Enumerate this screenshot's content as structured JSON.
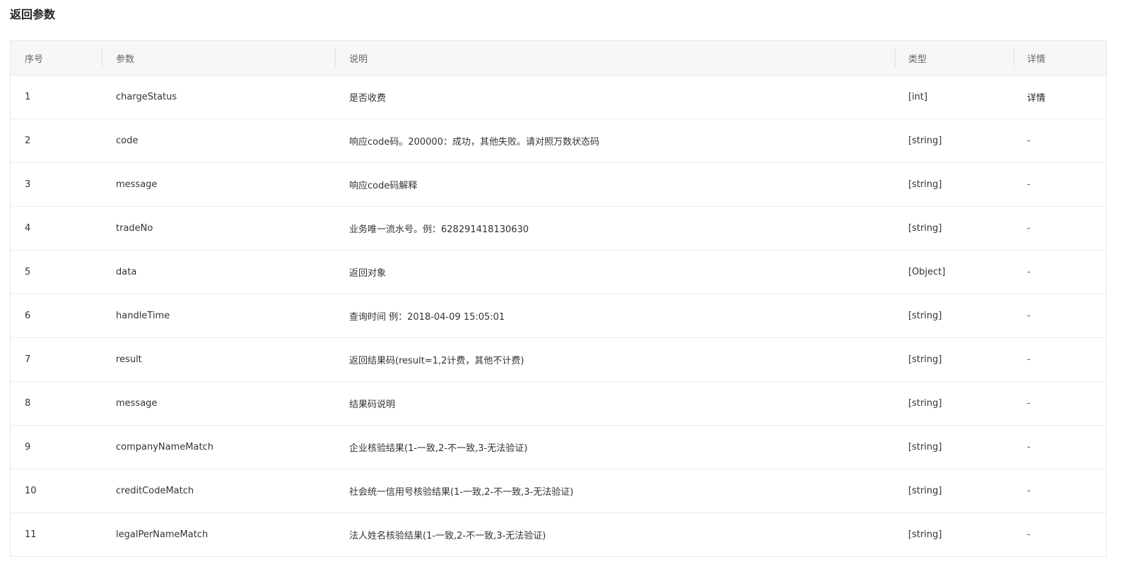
{
  "section": {
    "title": "返回参数"
  },
  "table": {
    "headers": {
      "no": "序号",
      "param": "参数",
      "desc": "说明",
      "type": "类型",
      "detail": "详情"
    },
    "rows": [
      {
        "no": "1",
        "param": "chargeStatus",
        "desc": "是否收费",
        "type": "[int]",
        "detail": "详情"
      },
      {
        "no": "2",
        "param": "code",
        "desc": "响应code码。200000：成功，其他失败。请对照万数状态码",
        "type": "[string]",
        "detail": "-"
      },
      {
        "no": "3",
        "param": "message",
        "desc": "响应code码解释",
        "type": "[string]",
        "detail": "-"
      },
      {
        "no": "4",
        "param": "tradeNo",
        "desc": "业务唯一流水号。例：628291418130630",
        "type": "[string]",
        "detail": "-"
      },
      {
        "no": "5",
        "param": "data",
        "desc": "返回对象",
        "type": "[Object]",
        "detail": "-"
      },
      {
        "no": "6",
        "param": "handleTime",
        "desc": "查询时间 例：2018-04-09 15:05:01",
        "type": "[string]",
        "detail": "-"
      },
      {
        "no": "7",
        "param": "result",
        "desc": "返回结果码(result=1,2计费，其他不计费)",
        "type": "[string]",
        "detail": "-"
      },
      {
        "no": "8",
        "param": "message",
        "desc": "结果码说明",
        "type": "[string]",
        "detail": "-"
      },
      {
        "no": "9",
        "param": "companyNameMatch",
        "desc": "企业核验结果(1-一致,2-不一致,3-无法验证)",
        "type": "[string]",
        "detail": "-"
      },
      {
        "no": "10",
        "param": "creditCodeMatch",
        "desc": "社会统一信用号核验结果(1-一致,2-不一致,3-无法验证)",
        "type": "[string]",
        "detail": "-"
      },
      {
        "no": "11",
        "param": "legalPerNameMatch",
        "desc": "法人姓名核验结果(1-一致,2-不一致,3-无法验证)",
        "type": "[string]",
        "detail": "-"
      }
    ]
  }
}
